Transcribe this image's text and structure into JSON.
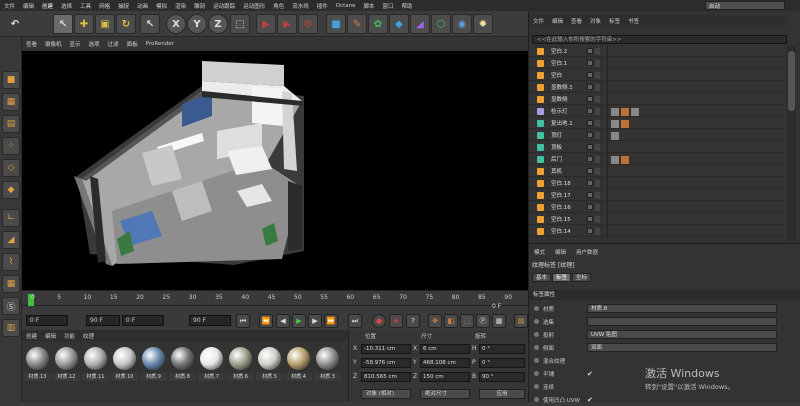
{
  "menubar": {
    "items": [
      "文件",
      "编辑",
      "创建",
      "选择",
      "工具",
      "网格",
      "捕捉",
      "动画",
      "模拟",
      "渲染",
      "雕刻",
      "运动跟踪",
      "运动图形",
      "角色",
      "流水线",
      "插件",
      "Octane",
      "脚本",
      "窗口",
      "帮助"
    ],
    "highlight_index": 2,
    "layout_label": "启动"
  },
  "toolbar": {
    "undo_icon": "↶",
    "axis_x": "X",
    "axis_y": "Y",
    "axis_z": "Z"
  },
  "viewport": {
    "menu": [
      "查看",
      "摄像机",
      "显示",
      "选项",
      "过滤",
      "面板",
      "ProRender"
    ],
    "background": "#000000"
  },
  "timeline": {
    "ticks": [
      "0",
      "5",
      "10",
      "15",
      "20",
      "25",
      "30",
      "35",
      "40",
      "45",
      "50",
      "55",
      "60",
      "65",
      "70",
      "75",
      "80",
      "85",
      "90"
    ],
    "frame_end_label": "0 F"
  },
  "transport": {
    "start_frame": "0 F",
    "current_frame": "0 F",
    "end_frame1": "90 F",
    "end_frame2": "90 F"
  },
  "materials": {
    "tabs": [
      "创建",
      "编辑",
      "功能",
      "纹理"
    ],
    "items": [
      {
        "label": "材质.13",
        "color": "#8a8a8a"
      },
      {
        "label": "材质.12",
        "color": "#9a9a9a"
      },
      {
        "label": "材质.11",
        "color": "#b0b0b0"
      },
      {
        "label": "材质.10",
        "color": "#c8c8c8"
      },
      {
        "label": "材质.9",
        "color": "#6a8ab0"
      },
      {
        "label": "材质.8",
        "color": "#777777"
      },
      {
        "label": "材质.7",
        "color": "#e8e8e8"
      },
      {
        "label": "材质.6",
        "color": "#a0a090"
      },
      {
        "label": "材质.5",
        "color": "#d0d0c8"
      },
      {
        "label": "材质.4",
        "color": "#b8a070"
      },
      {
        "label": "材质.3",
        "color": "#909090"
      }
    ]
  },
  "coords": {
    "headers": {
      "pos": "位置",
      "size": "尺寸",
      "rot": "旋转"
    },
    "x": {
      "label": "X",
      "pos": "-10.311 cm",
      "size": "6 cm",
      "rot_label": "H",
      "rot": "0 °"
    },
    "y": {
      "label": "Y",
      "pos": "-58.976 cm",
      "size": "468.108 cm",
      "rot_label": "P",
      "rot": "0 °"
    },
    "z": {
      "label": "Z",
      "pos": "810.565 cm",
      "size": "150 cm",
      "rot_label": "B",
      "rot": "90 °"
    },
    "mode_select": "对象 (相对)",
    "size_select": "绝对尺寸",
    "apply": "应用"
  },
  "objects": {
    "tabs": [
      "文件",
      "编辑",
      "查看",
      "对象",
      "标签",
      "书签"
    ],
    "search_placeholder": "<<在此输入你所搜索的字符串>>",
    "rows": [
      {
        "name": "空白.2",
        "color": "#f0a030",
        "tags": 0
      },
      {
        "name": "空白.1",
        "color": "#f0a030",
        "tags": 0
      },
      {
        "name": "空白",
        "color": "#f0a030",
        "tags": 0
      },
      {
        "name": "显数侧.1",
        "color": "#f0a030",
        "tags": 0
      },
      {
        "name": "显数侧",
        "color": "#f0a030",
        "tags": 0
      },
      {
        "name": "检示灯",
        "color": "#a0a0e0",
        "tags": 3
      },
      {
        "name": "复出地.1",
        "color": "#40c0a0",
        "tags": 2
      },
      {
        "name": "顶灯",
        "color": "#40c0a0",
        "tags": 1
      },
      {
        "name": "顶板",
        "color": "#40c0a0",
        "tags": 0
      },
      {
        "name": "后门",
        "color": "#40c0a0",
        "tags": 2
      },
      {
        "name": "其机",
        "color": "#f0a030",
        "tags": 0
      },
      {
        "name": "空白.18",
        "color": "#f0a030",
        "tags": 0
      },
      {
        "name": "空白.17",
        "color": "#f0a030",
        "tags": 0
      },
      {
        "name": "空白.16",
        "color": "#f0a030",
        "tags": 0
      },
      {
        "name": "空白.15",
        "color": "#f0a030",
        "tags": 0
      },
      {
        "name": "空白.14",
        "color": "#f0a030",
        "tags": 0
      }
    ]
  },
  "attributes": {
    "menu": [
      "模式",
      "编辑",
      "用户数据"
    ],
    "header": "纹理标签 [纹理]",
    "tabs": [
      "基本",
      "标签",
      "坐标"
    ],
    "section": "标签属性",
    "rows": [
      {
        "label": "材质",
        "value": "材质.8",
        "type": "field"
      },
      {
        "label": "选集",
        "value": "",
        "type": "field"
      },
      {
        "label": "投射",
        "value": "UVW 贴图",
        "type": "field"
      },
      {
        "label": "侧面",
        "value": "双面",
        "type": "field"
      },
      {
        "label": "混合纹理",
        "value": "",
        "type": "check"
      },
      {
        "label": "平铺",
        "value": "✔",
        "type": "check"
      },
      {
        "label": "连续",
        "value": "",
        "type": "check"
      },
      {
        "label": "使用凹凸 UVW",
        "value": "✔",
        "type": "check"
      }
    ]
  },
  "watermark": {
    "title": "激活 Windows",
    "subtitle": "转到\"设置\"以激活 Windows。"
  }
}
